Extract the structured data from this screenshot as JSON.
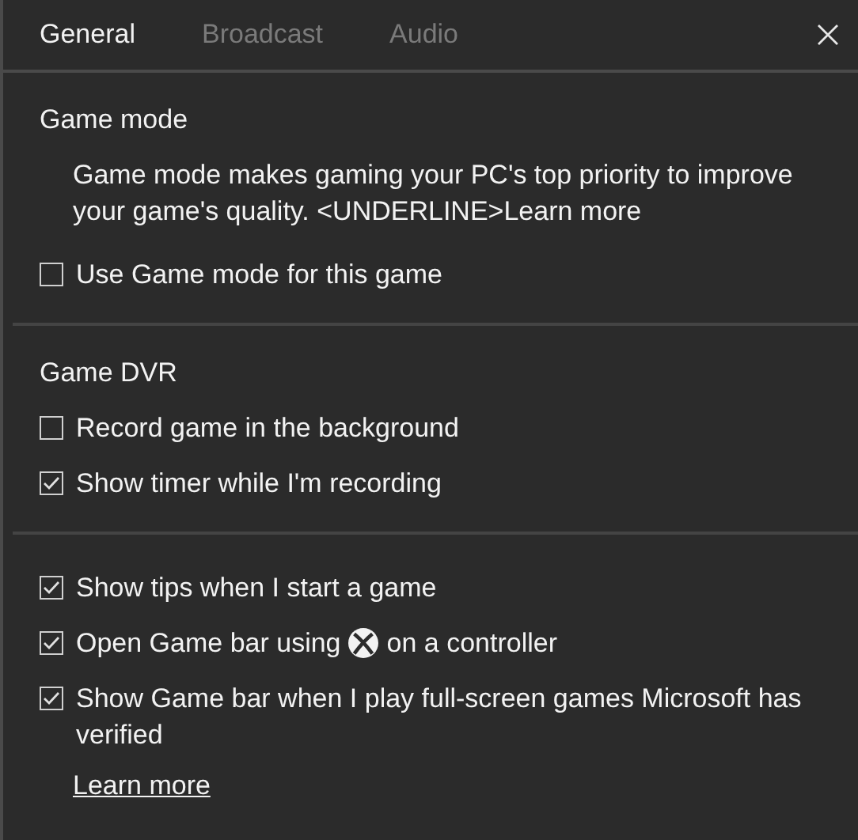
{
  "tabs": [
    {
      "label": "General",
      "selected": true
    },
    {
      "label": "Broadcast",
      "selected": false
    },
    {
      "label": "Audio",
      "selected": false
    }
  ],
  "sections": [
    {
      "title": "Game mode",
      "description": "Game mode makes gaming your PC's top priority to improve your game's quality. <UNDERLINE>Learn more",
      "options": [
        {
          "kind": "checkbox",
          "label": "Use Game mode for this game",
          "checked": false
        }
      ]
    },
    {
      "title": "Game DVR",
      "options": [
        {
          "kind": "checkbox",
          "label": "Record game in the background",
          "checked": false
        },
        {
          "kind": "checkbox",
          "label": "Show timer while I'm recording",
          "checked": true
        }
      ]
    },
    {
      "options": [
        {
          "kind": "checkbox",
          "label": "Show tips when I start a game",
          "checked": true
        },
        {
          "kind": "icon_checkbox",
          "label_before": "Open Game bar using",
          "label_after": "on a controller",
          "checked": true
        },
        {
          "kind": "checkbox",
          "label": "Show Game bar when I play full-screen games Microsoft has verified",
          "checked": true
        }
      ],
      "link": "Learn more"
    }
  ]
}
